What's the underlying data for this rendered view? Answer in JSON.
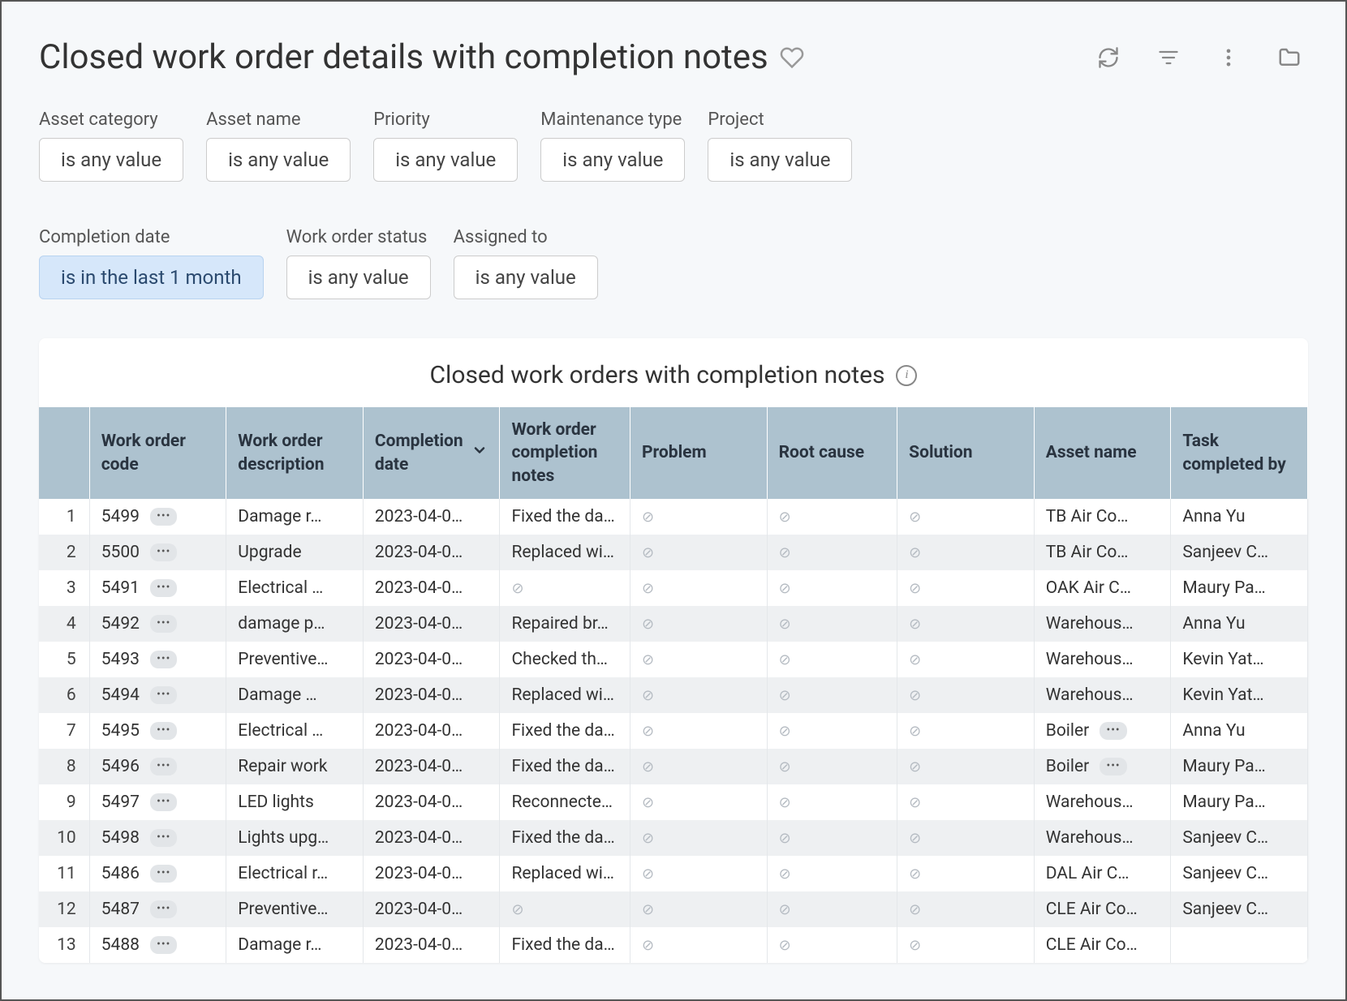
{
  "page": {
    "title": "Closed work order details with completion notes"
  },
  "filters": [
    {
      "label": "Asset category",
      "value": "is any value",
      "active": false
    },
    {
      "label": "Asset name",
      "value": "is any value",
      "active": false
    },
    {
      "label": "Priority",
      "value": "is any value",
      "active": false
    },
    {
      "label": "Maintenance type",
      "value": "is any value",
      "active": false
    },
    {
      "label": "Project",
      "value": "is any value",
      "active": false
    },
    {
      "label": "Completion date",
      "value": "is in the last 1 month",
      "active": true
    },
    {
      "label": "Work order status",
      "value": "is any value",
      "active": false
    },
    {
      "label": "Assigned to",
      "value": "is any value",
      "active": false
    }
  ],
  "table": {
    "title": "Closed work orders with completion notes",
    "columns": [
      "Work order code",
      "Work order description",
      "Completion date",
      "Work order completion notes",
      "Problem",
      "Root cause",
      "Solution",
      "Asset name",
      "Task completed by"
    ],
    "sorted_column_index": 2,
    "rows": [
      {
        "n": "1",
        "code": "5499",
        "desc": "Damage r…",
        "date": "2023-04-0…",
        "notes": "Fixed the da…",
        "problem": "",
        "root": "",
        "sol": "",
        "asset": "TB Air Co…",
        "asset_badge": false,
        "by": "Anna Yu"
      },
      {
        "n": "2",
        "code": "5500",
        "desc": "Upgrade",
        "date": "2023-04-0…",
        "notes": "Replaced wi…",
        "problem": "",
        "root": "",
        "sol": "",
        "asset": "TB Air Co…",
        "asset_badge": false,
        "by": "Sanjeev C…"
      },
      {
        "n": "3",
        "code": "5491",
        "desc": "Electrical …",
        "date": "2023-04-0…",
        "notes": "",
        "problem": "",
        "root": "",
        "sol": "",
        "asset": "OAK Air C…",
        "asset_badge": false,
        "by": "Maury Pa…"
      },
      {
        "n": "4",
        "code": "5492",
        "desc": "damage p…",
        "date": "2023-04-0…",
        "notes": "Repaired br…",
        "problem": "",
        "root": "",
        "sol": "",
        "asset": "Warehous…",
        "asset_badge": false,
        "by": "Anna Yu"
      },
      {
        "n": "5",
        "code": "5493",
        "desc": "Preventive…",
        "date": "2023-04-0…",
        "notes": "Checked th…",
        "problem": "",
        "root": "",
        "sol": "",
        "asset": "Warehous…",
        "asset_badge": false,
        "by": "Kevin Yat…"
      },
      {
        "n": "6",
        "code": "5494",
        "desc": "Damage …",
        "date": "2023-04-0…",
        "notes": "Replaced wi…",
        "problem": "",
        "root": "",
        "sol": "",
        "asset": "Warehous…",
        "asset_badge": false,
        "by": "Kevin Yat…"
      },
      {
        "n": "7",
        "code": "5495",
        "desc": "Electrical …",
        "date": "2023-04-0…",
        "notes": "Fixed the da…",
        "problem": "",
        "root": "",
        "sol": "",
        "asset": "Boiler",
        "asset_badge": true,
        "by": "Anna Yu"
      },
      {
        "n": "8",
        "code": "5496",
        "desc": "Repair work",
        "date": "2023-04-0…",
        "notes": "Fixed the da…",
        "problem": "",
        "root": "",
        "sol": "",
        "asset": "Boiler",
        "asset_badge": true,
        "by": "Maury Pa…"
      },
      {
        "n": "9",
        "code": "5497",
        "desc": "LED lights",
        "date": "2023-04-0…",
        "notes": "Reconnecte…",
        "problem": "",
        "root": "",
        "sol": "",
        "asset": "Warehous…",
        "asset_badge": false,
        "by": "Maury Pa…"
      },
      {
        "n": "10",
        "code": "5498",
        "desc": "Lights upg…",
        "date": "2023-04-0…",
        "notes": "Fixed the da…",
        "problem": "",
        "root": "",
        "sol": "",
        "asset": "Warehous…",
        "asset_badge": false,
        "by": "Sanjeev C…"
      },
      {
        "n": "11",
        "code": "5486",
        "desc": "Electrical r…",
        "date": "2023-04-0…",
        "notes": "Replaced wi…",
        "problem": "",
        "root": "",
        "sol": "",
        "asset": "DAL Air C…",
        "asset_badge": false,
        "by": "Sanjeev C…"
      },
      {
        "n": "12",
        "code": "5487",
        "desc": "Preventive…",
        "date": "2023-04-0…",
        "notes": "",
        "problem": "",
        "root": "",
        "sol": "",
        "asset": "CLE Air Co…",
        "asset_badge": false,
        "by": "Sanjeev C…"
      },
      {
        "n": "13",
        "code": "5488",
        "desc": "Damage r…",
        "date": "2023-04-0…",
        "notes": "Fixed the da…",
        "problem": "",
        "root": "",
        "sol": "",
        "asset": "CLE Air Co…",
        "asset_badge": false,
        "by": ""
      }
    ]
  }
}
